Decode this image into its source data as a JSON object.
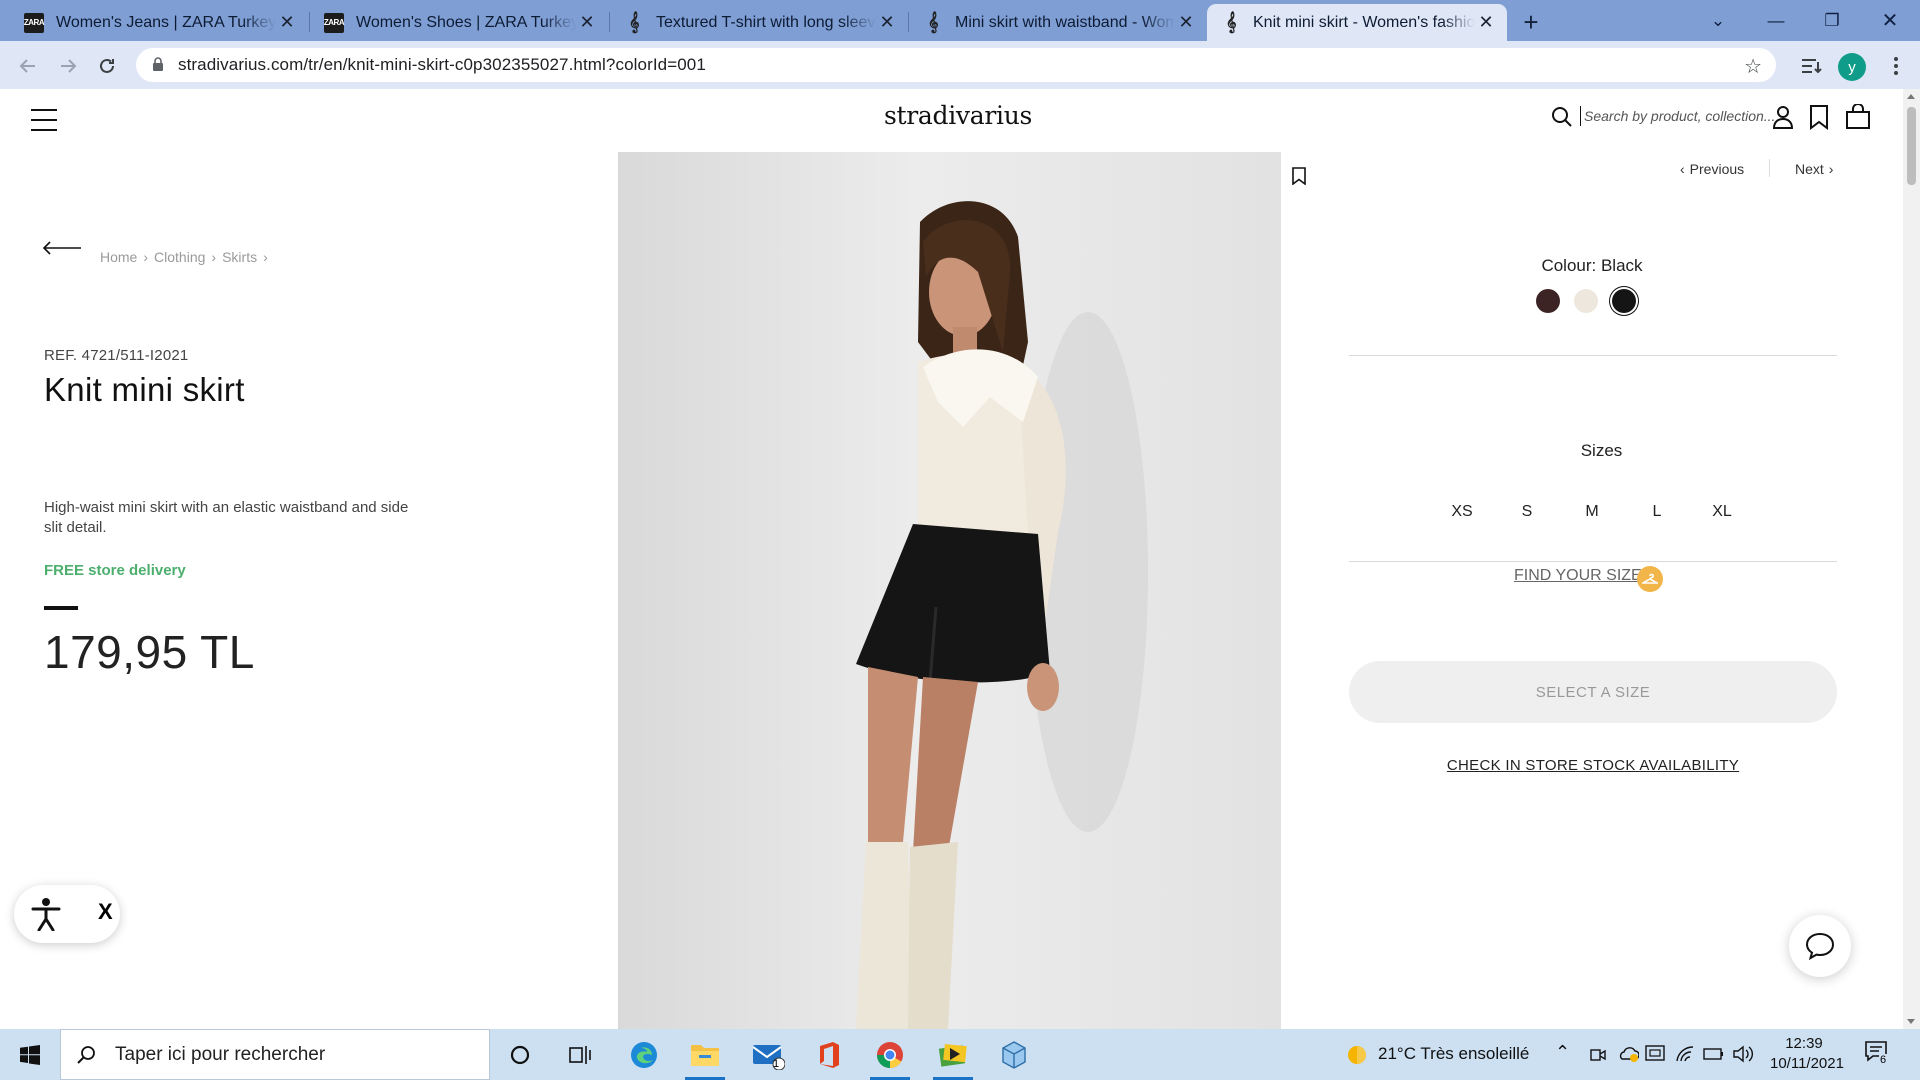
{
  "browser": {
    "tabs": [
      {
        "title": "Women's Jeans | ZARA Turkey",
        "favicon": "zara-favicon"
      },
      {
        "title": "Women's Shoes | ZARA Turkey",
        "favicon": "zara-favicon"
      },
      {
        "title": "Textured T-shirt with long sleeves",
        "favicon": "stradivarius-favicon"
      },
      {
        "title": "Mini skirt with waistband - Women",
        "favicon": "stradivarius-favicon"
      },
      {
        "title": "Knit mini skirt - Women's fashion",
        "favicon": "stradivarius-favicon",
        "active": true
      }
    ],
    "url": "stradivarius.com/tr/en/knit-mini-skirt-c0p302355027.html?colorId=001",
    "profile_initial": "y",
    "frame_color": "#7f9ed4",
    "toolbar_color": "#dfe7f6"
  },
  "header": {
    "logo": "stradivarius",
    "search_placeholder": "Search by product, collection..."
  },
  "breadcrumb": [
    "Home",
    "Clothing",
    "Skirts"
  ],
  "product": {
    "ref": "REF. 4721/511-I2021",
    "title": "Knit mini skirt",
    "description": "High-waist mini skirt with an elastic waistband and side slit detail.",
    "free_delivery": "FREE store delivery",
    "price": "179,95 TL",
    "image": "model wearing cream rib-knit cardigan with faux-fur collar, black knit mini skirt with front slit and cream knee-high boots, leaning against a light grey wall"
  },
  "pager": {
    "previous": "Previous",
    "next": "Next"
  },
  "colour": {
    "label": "Colour: Black",
    "swatches": [
      {
        "name": "brown",
        "hex": "#3d2424"
      },
      {
        "name": "cream",
        "hex": "#ede7dd"
      },
      {
        "name": "black",
        "hex": "#151515",
        "selected": true
      }
    ]
  },
  "sizes": {
    "label": "Sizes",
    "options": [
      "XS",
      "S",
      "M",
      "L",
      "XL"
    ],
    "find_size": "FIND YOUR SIZE",
    "select_button": "SELECT A SIZE",
    "stock_link": "CHECK IN STORE STOCK AVAILABILITY"
  },
  "accessibility_widget": {
    "close_label": "X"
  },
  "taskbar": {
    "search_placeholder": "Taper ici pour rechercher",
    "weather": "21°C  Très ensoleillé",
    "time": "12:39",
    "date": "10/11/2021",
    "mail_badge": "1",
    "notification_count": "6",
    "accent": "#1a73c7"
  }
}
